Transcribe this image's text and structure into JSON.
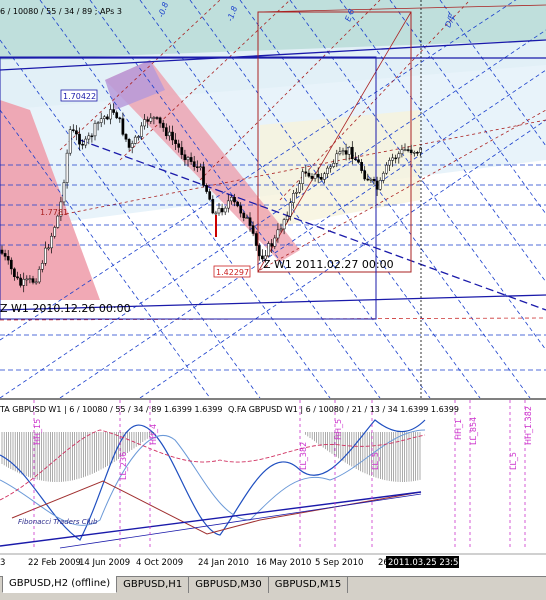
{
  "main_header": "6 / 10080 / 55 / 34 / 89 ; APs 3",
  "price_boxes": {
    "high": "1.70422",
    "low": "1.42297"
  },
  "zone_labels": {
    "left": "Z W1   2010.12.26 00:00",
    "right": "Z W1   2011.02.27 00:00"
  },
  "mid_label": "1.7781",
  "fib_labels": [
    "-0.8",
    "-1.8",
    "E 8",
    "D/E"
  ],
  "indicator_header_1": "TA GBPUSD W1 | 6 / 10080 / 55 / 34 / 89 1.6399 1.6399",
  "indicator_header_2": "Q.FA GBPUSD W1 | 6 / 10080 / 21 / 13 / 34 1.6399 1.6399",
  "watermark": "Fibonacci Traders Club",
  "vline_labels": [
    "HH_15",
    "LL_236",
    "HH_4",
    "LL_382",
    "HH_5",
    "LL_5",
    "HH_1",
    "LL_854",
    "LL_5",
    "HH_1.382"
  ],
  "x_axis": [
    "3",
    "22 Feb 2009",
    "14 Jun 2009",
    "4 Oct 2009",
    "24 Jan 2010",
    "16 May 2010",
    "5 Sep 2010",
    "26"
  ],
  "cursor_time": "2011.03.25 23:59",
  "tabs": [
    "GBPUSD,H2 (offline)",
    "GBPUSD,H1",
    "GBPUSD,M30",
    "GBPUSD,M15"
  ],
  "colors": {
    "up": "#ffffff",
    "down": "#000000",
    "frame": "#aa2222",
    "trend": "#1a1aaa",
    "cyan_band": "#b8dcd8",
    "red_band": "#ee9aa8",
    "purple_band": "#b79ad9"
  }
}
